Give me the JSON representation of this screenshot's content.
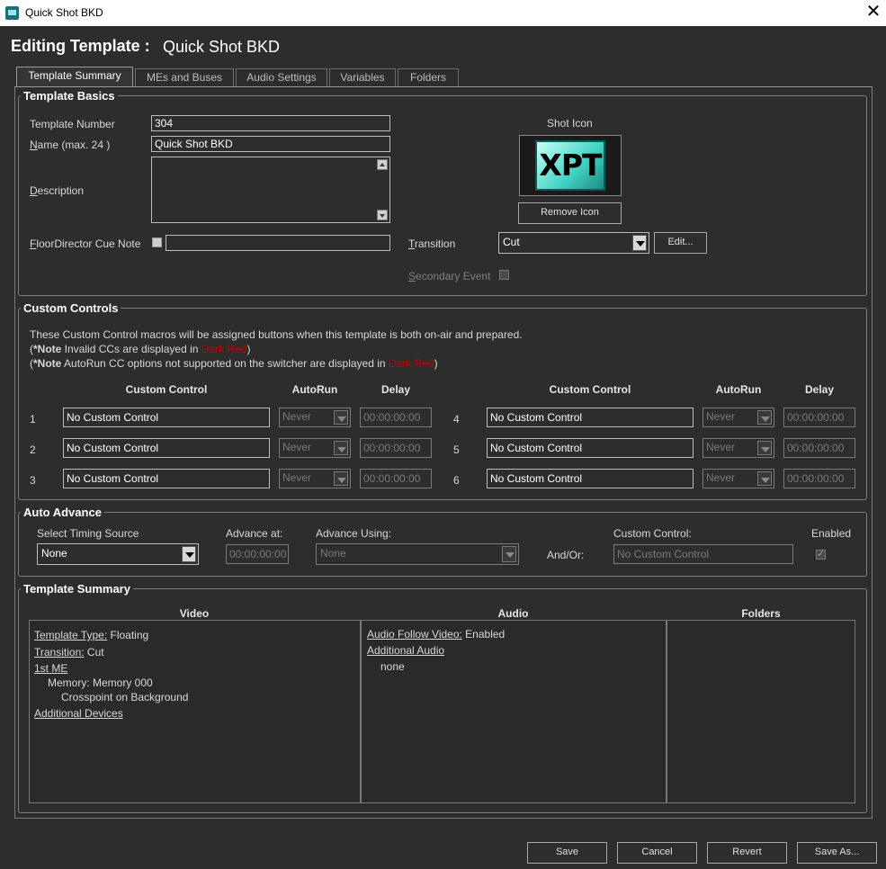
{
  "window": {
    "title": "Quick Shot BKD"
  },
  "heading": {
    "label": "Editing Template :",
    "value": "Quick Shot BKD"
  },
  "tabs": [
    "Template Summary",
    "MEs and Buses",
    "Audio Settings",
    "Variables",
    "Folders"
  ],
  "basics": {
    "title": "Template Basics",
    "template_number_label": "Template Number",
    "template_number": "304",
    "name_label_u": "N",
    "name_label_rest": "ame (max. 24 )",
    "name_value": "Quick Shot BKD",
    "description_label_u": "D",
    "description_label_rest": "escription",
    "floor_label_u": "F",
    "floor_label_rest": "loorDirector Cue Note",
    "shot_icon_label": "Shot Icon",
    "shot_icon_text": "XPT",
    "remove_icon": "Remove Icon",
    "transition_label_u": "T",
    "transition_label_rest": "ransition",
    "transition_value": "Cut",
    "edit_button": "Edit...",
    "secondary_event_label_u": "S",
    "secondary_event_label_rest": "econdary Event"
  },
  "custom_controls": {
    "title": "Custom Controls",
    "info1": "These Custom Control macros will be assigned buttons when this template is both on-air and prepared.",
    "note1_pre": "(",
    "note_bold": "*Note",
    "note1_text": " Invalid CCs are displayed in ",
    "dark_red": "Dark Red",
    "note_close": ")",
    "note2_text": " AutoRun CC options not supported on the switcher are displayed in ",
    "col_custom_control": "Custom Control",
    "col_autorun": "AutoRun",
    "col_delay": "Delay",
    "rows": [
      {
        "num": "1",
        "control": "No Custom Control",
        "autorun": "Never",
        "delay": "00:00:00:00"
      },
      {
        "num": "2",
        "control": "No Custom Control",
        "autorun": "Never",
        "delay": "00:00:00:00"
      },
      {
        "num": "3",
        "control": "No Custom Control",
        "autorun": "Never",
        "delay": "00:00:00:00"
      },
      {
        "num": "4",
        "control": "No Custom Control",
        "autorun": "Never",
        "delay": "00:00:00:00"
      },
      {
        "num": "5",
        "control": "No Custom Control",
        "autorun": "Never",
        "delay": "00:00:00:00"
      },
      {
        "num": "6",
        "control": "No Custom Control",
        "autorun": "Never",
        "delay": "00:00:00:00"
      }
    ]
  },
  "auto_advance": {
    "title": "Auto Advance",
    "timing_label": "Select Timing Source",
    "timing_value": "None",
    "advance_at_label": "Advance at:",
    "advance_at_value": "00:00:00:00",
    "advance_using_label": "Advance Using:",
    "advance_using_value": "None",
    "and_or": "And/Or:",
    "custom_control_label": "Custom Control:",
    "custom_control_value": "No Custom Control",
    "enabled_label": "Enabled"
  },
  "summary": {
    "title": "Template Summary",
    "col_video": "Video",
    "col_audio": "Audio",
    "col_folders": "Folders",
    "video": {
      "type_label": "Template Type:",
      "type_value": " Floating",
      "transition_label": "Transition:",
      "transition_value": " Cut",
      "me_label": "1st ME",
      "memory_line": "Memory: Memory 000",
      "crosspoint_line": "Crosspoint on Background",
      "additional_devices": "Additional Devices"
    },
    "audio": {
      "follow_label": "Audio Follow Video:",
      "follow_value": " Enabled",
      "additional_audio": "Additional Audio",
      "additional_value": "none"
    }
  },
  "footer": {
    "save": "Save",
    "cancel": "Cancel",
    "revert": "Revert",
    "save_as": "Save As..."
  }
}
